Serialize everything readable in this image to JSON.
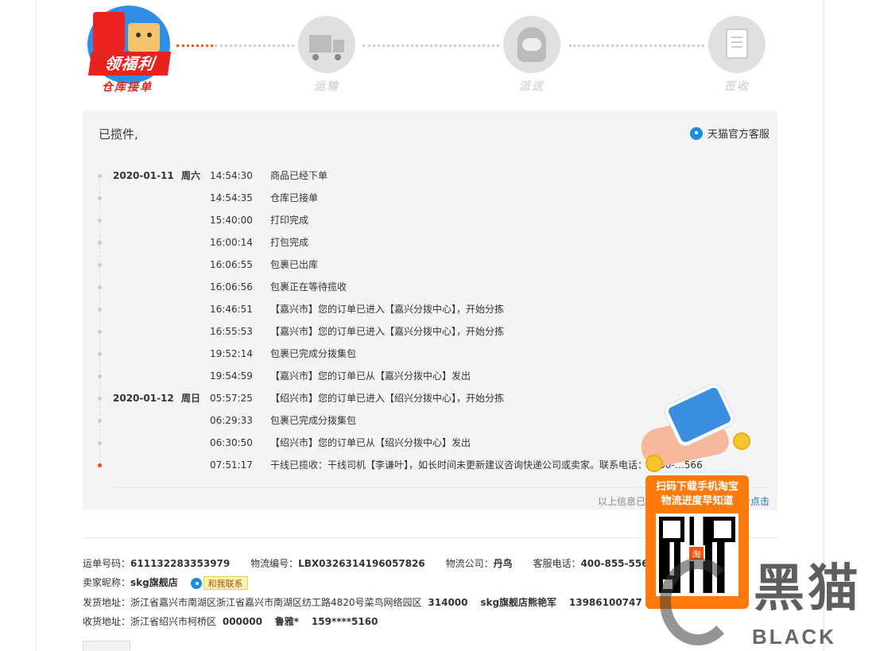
{
  "steps": [
    {
      "label": "仓库接单",
      "badge": "领福利",
      "state": "active"
    },
    {
      "label": "运输",
      "state": "pending"
    },
    {
      "label": "派送",
      "state": "pending"
    },
    {
      "label": "签收",
      "state": "pending"
    }
  ],
  "tracking": {
    "status_title": "已揽件,",
    "service_link": "天猫官方客服",
    "events": [
      {
        "date": "2020-01-11",
        "weekday": "周六",
        "time": "14:54:30",
        "desc": "商品已经下单"
      },
      {
        "date": "",
        "weekday": "",
        "time": "14:54:35",
        "desc": "仓库已接单"
      },
      {
        "date": "",
        "weekday": "",
        "time": "15:40:00",
        "desc": "打印完成"
      },
      {
        "date": "",
        "weekday": "",
        "time": "16:00:14",
        "desc": "打包完成"
      },
      {
        "date": "",
        "weekday": "",
        "time": "16:06:55",
        "desc": "包裹已出库"
      },
      {
        "date": "",
        "weekday": "",
        "time": "16:06:56",
        "desc": "包裹正在等待揽收"
      },
      {
        "date": "",
        "weekday": "",
        "time": "16:46:51",
        "desc": "【嘉兴市】您的订单已进入【嘉兴分拨中心】，开始分拣"
      },
      {
        "date": "",
        "weekday": "",
        "time": "16:55:53",
        "desc": "【嘉兴市】您的订单已进入【嘉兴分拨中心】，开始分拣"
      },
      {
        "date": "",
        "weekday": "",
        "time": "19:52:14",
        "desc": "包裹已完成分拨集包"
      },
      {
        "date": "",
        "weekday": "",
        "time": "19:54:59",
        "desc": "【嘉兴市】您的订单已从【嘉兴分拨中心】发出"
      },
      {
        "date": "2020-01-12",
        "weekday": "周日",
        "time": "05:57:25",
        "desc": "【绍兴市】您的订单已进入【绍兴分拨中心】，开始分拣"
      },
      {
        "date": "",
        "weekday": "",
        "time": "06:29:33",
        "desc": "包裹已完成分拨集包"
      },
      {
        "date": "",
        "weekday": "",
        "time": "06:30:50",
        "desc": "【绍兴市】您的订单已从【绍兴分拨中心】发出"
      },
      {
        "date": "",
        "weekday": "",
        "time": "07:51:17",
        "desc": "干线已揽收：干线司机【李谦叶】，如长时间未更新建议咨询快递公司或卖家。联系电话：5100-…566"
      }
    ],
    "notice_text": "以上信息已经过优化处理，如需查",
    "notice_link": "看点击"
  },
  "info": {
    "waybill_label": "运单号码：",
    "waybill": "611132283353979",
    "logistics_label": "物流编号：",
    "logistics": "LBX0326314196057826",
    "company_label": "物流公司：",
    "company": "丹鸟",
    "hotline_label": "客服电话：",
    "hotline": "400-855-5566",
    "seller_label": "卖家昵称：",
    "seller": "skg旗舰店",
    "contact_btn": "和我联系",
    "ship_label": "发货地址：",
    "ship_addr": "浙江省嘉兴市南湖区浙江省嘉兴市南湖区纺工路4820号菜鸟网络园区",
    "ship_zip": "314000",
    "ship_name": "skg旗舰店熊艳军",
    "ship_phone": "13986100747",
    "recv_label": "收货地址：",
    "recv_addr": "浙江省绍兴市柯桥区",
    "recv_zip": "000000",
    "recv_name": "鲁雅*",
    "recv_phone": "159****5160"
  },
  "promo": {
    "line1": "扫码下载手机淘宝",
    "line2": "物流进度早知道",
    "qr_logo": "淘"
  },
  "watermark": {
    "big": "黑猫",
    "small": "BLACK CAT"
  }
}
